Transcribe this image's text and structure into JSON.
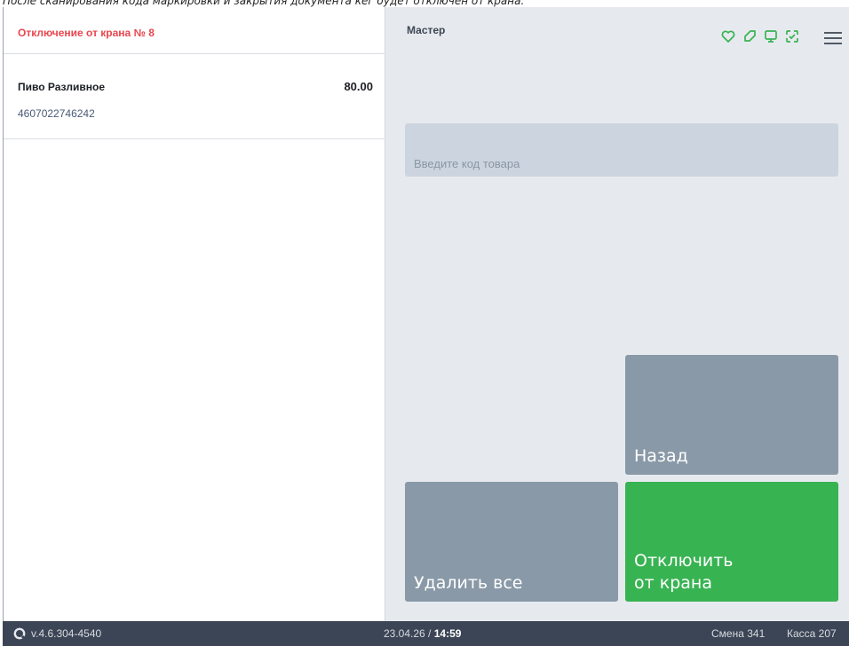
{
  "caption": "После сканирования кода маркировки и закрытия документа кег будет отключен от крана.",
  "document": {
    "title": "Отключение от крана № 8"
  },
  "items": [
    {
      "name": "Пиво Разливное",
      "price": "80.00",
      "code": "4607022746242"
    }
  ],
  "header": {
    "user": "Мастер",
    "icons": [
      "heart-icon",
      "tag-icon",
      "monitor-icon",
      "scan-icon",
      "menu-icon"
    ]
  },
  "search": {
    "placeholder": "Введите код товара"
  },
  "buttons": {
    "back": "Назад",
    "clear_all": "Удалить все",
    "disconnect": "Отключить\nот крана"
  },
  "status": {
    "version": "v.4.6.304-4540",
    "date": "23.04.26 / ",
    "time": "14:59",
    "shift": "Смена 341",
    "kassa": "Касса 207"
  },
  "colors": {
    "accent_green": "#38b352",
    "title_red": "#e8464e",
    "button_gray": "#8999a7",
    "status_bar": "#3c4555"
  }
}
